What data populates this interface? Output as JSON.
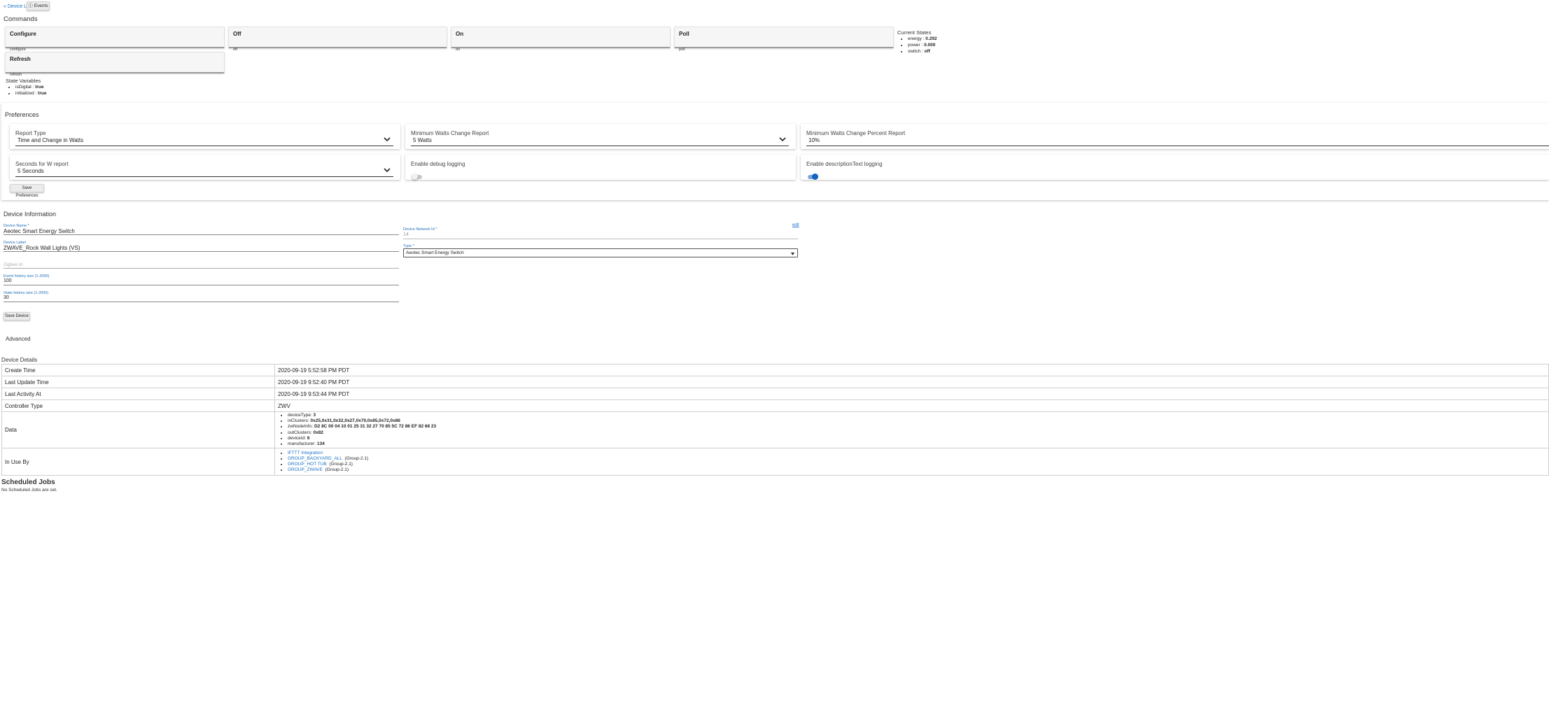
{
  "topbar": {
    "device_list_link": "« Device List",
    "events_button": "ⓘ Events"
  },
  "commands": {
    "heading": "Commands",
    "items": [
      {
        "title": "Configure",
        "sub": "configure"
      },
      {
        "title": "Off",
        "sub": "off"
      },
      {
        "title": "On",
        "sub": "on"
      },
      {
        "title": "Poll",
        "sub": "poll"
      },
      {
        "title": "Refresh",
        "sub": "refresh"
      }
    ]
  },
  "current_states": {
    "heading": "Current States",
    "items": [
      {
        "key": "energy",
        "value": "0.292"
      },
      {
        "key": "power",
        "value": "0.000"
      },
      {
        "key": "switch",
        "value": "off"
      }
    ]
  },
  "state_variables": {
    "heading": "State Variables",
    "items": [
      {
        "key": "isDigital",
        "value": "true"
      },
      {
        "key": "initialized",
        "value": "true"
      }
    ]
  },
  "preferences": {
    "heading": "Preferences",
    "report_type": {
      "label": "Report Type",
      "value": "Time and Change in Watts"
    },
    "min_watts": {
      "label": "Minimum Watts Change Report",
      "value": "5 Watts"
    },
    "min_percent": {
      "label": "Minimum Watts Change Percent Report",
      "value": "10%"
    },
    "seconds_w": {
      "label": "Seconds for W report",
      "value": "5 Seconds"
    },
    "debug_logging": {
      "label": "Enable debug logging",
      "on": false
    },
    "desc_logging": {
      "label": "Enable descriptionText logging",
      "on": true
    },
    "save_button": "Save Preferences"
  },
  "device_info": {
    "heading": "Device Information",
    "name_label": "Device Name *",
    "name_value": "Aeotec Smart Energy Switch",
    "label_label": "Device Label",
    "label_value": "ZWAVE_Rock Wall Lights (VS)",
    "zigbee_placeholder": "Zigbee Id",
    "event_history_label": "Event history size (1-2000)",
    "event_history_value": "100",
    "state_history_label": "State history size (1-2000)",
    "state_history_value": "30",
    "network_id_label": "Device Network Id *",
    "network_id_value": "14",
    "edit_link": "edit",
    "type_label": "Type *",
    "type_value": "Aeotec Smart Energy Switch",
    "save_button": "Save Device",
    "advanced": "Advanced"
  },
  "device_details": {
    "heading": "Device Details",
    "rows": [
      {
        "key": "Create Time",
        "value": "2020-09-19 5:52:58 PM PDT"
      },
      {
        "key": "Last Update Time",
        "value": "2020-09-19 9:52:40 PM PDT"
      },
      {
        "key": "Last Activity At",
        "value": "2020-09-19 9:53:44 PM PDT"
      },
      {
        "key": "Controller Type",
        "value": "ZWV"
      }
    ],
    "data_key": "Data",
    "data_items": [
      {
        "key": "deviceType",
        "value": "3"
      },
      {
        "key": "inClusters",
        "value": "0x25,0x31,0x32,0x27,0x70,0x85,0x72,0x86"
      },
      {
        "key": "zwNodeInfo",
        "value": "D2 8C 00 04 10 01 25 31 32 27 70 85 5C 72 86 EF 82 68 23"
      },
      {
        "key": "outClusters",
        "value": "0x82"
      },
      {
        "key": "deviceId",
        "value": "6"
      },
      {
        "key": "manufacturer",
        "value": "134"
      }
    ],
    "inuse_key": "In Use By",
    "inuse_items": [
      {
        "link": "IFTTT Integration",
        "suffix": ""
      },
      {
        "link": "GROUP_BACKYARD_ALL",
        "suffix": "(Group-2.1)"
      },
      {
        "link": "GROUP_HOT TUB",
        "suffix": "(Group-2.1)"
      },
      {
        "link": "GROUP_ZWAVE",
        "suffix": "(Group-2.1)"
      }
    ]
  },
  "scheduled_jobs": {
    "heading": "Scheduled Jobs",
    "empty_text": "No Scheduled Jobs are set."
  },
  "colors": {
    "accent": "#1a73c8",
    "toggle_on": "#1565c0"
  }
}
